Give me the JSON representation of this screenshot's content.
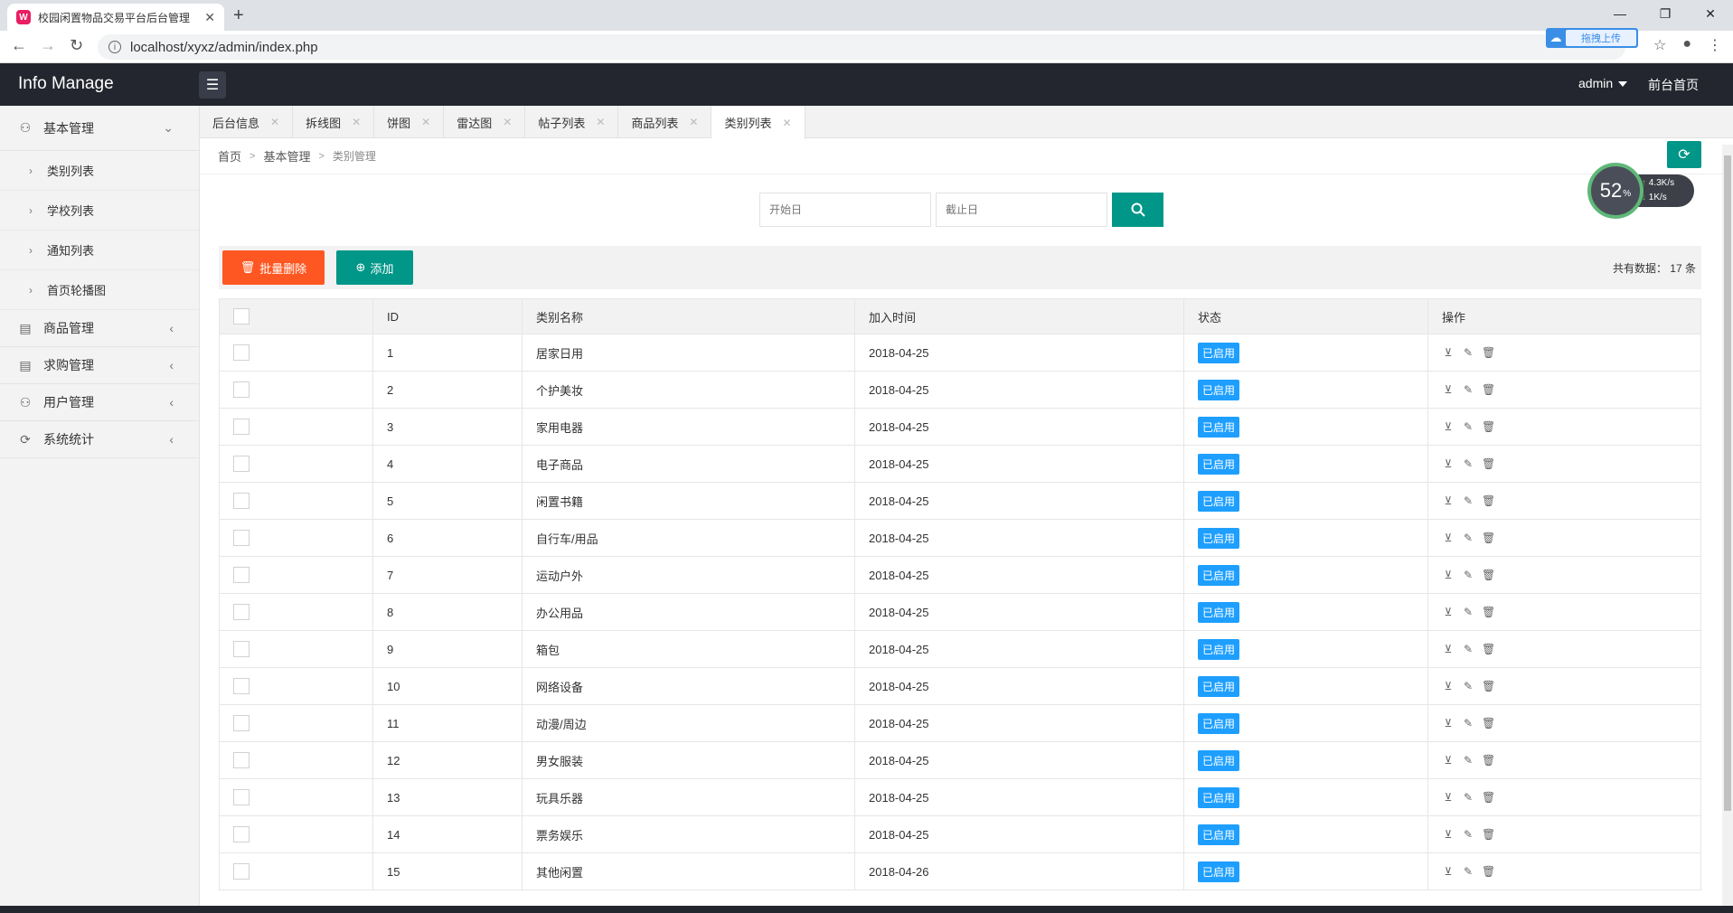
{
  "browser": {
    "tab_title": "校园闲置物品交易平台后台管理",
    "tab_favicon_letter": "W",
    "url": "localhost/xyxz/admin/index.php",
    "extension_label": "拖拽上传"
  },
  "header": {
    "logo": "Info Manage",
    "user": "admin",
    "home_link": "前台首页"
  },
  "sidebar": {
    "groups": [
      {
        "label": "基本管理",
        "icon": "user-icon",
        "expanded": true,
        "items": [
          "类别列表",
          "学校列表",
          "通知列表",
          "首页轮播图"
        ]
      },
      {
        "label": "商品管理",
        "icon": "document-icon"
      },
      {
        "label": "求购管理",
        "icon": "document-icon"
      },
      {
        "label": "用户管理",
        "icon": "user-icon"
      },
      {
        "label": "系统统计",
        "icon": "chart-icon"
      }
    ]
  },
  "tabs": [
    "后台信息",
    "拆线图",
    "饼图",
    "雷达图",
    "帖子列表",
    "商品列表",
    "类别列表"
  ],
  "active_tab": "类别列表",
  "breadcrumb": [
    "首页",
    "基本管理",
    "类别管理"
  ],
  "speed_widget": {
    "percent": "52",
    "unit": "%",
    "up": "4.3K/s",
    "down": "1K/s"
  },
  "search": {
    "start_placeholder": "开始日",
    "end_placeholder": "截止日"
  },
  "toolbar": {
    "batch_delete": "批量删除",
    "add": "添加",
    "total_label": "共有数据： 17 条"
  },
  "table": {
    "headers": [
      "ID",
      "类别名称",
      "加入时间",
      "状态",
      "操作"
    ],
    "rows": [
      {
        "id": "1",
        "name": "居家日用",
        "date": "2018-04-25",
        "status": "已启用"
      },
      {
        "id": "2",
        "name": "个护美妆",
        "date": "2018-04-25",
        "status": "已启用"
      },
      {
        "id": "3",
        "name": "家用电器",
        "date": "2018-04-25",
        "status": "已启用"
      },
      {
        "id": "4",
        "name": "电子商品",
        "date": "2018-04-25",
        "status": "已启用"
      },
      {
        "id": "5",
        "name": "闲置书籍",
        "date": "2018-04-25",
        "status": "已启用"
      },
      {
        "id": "6",
        "name": "自行车/用品",
        "date": "2018-04-25",
        "status": "已启用"
      },
      {
        "id": "7",
        "name": "运动户外",
        "date": "2018-04-25",
        "status": "已启用"
      },
      {
        "id": "8",
        "name": "办公用品",
        "date": "2018-04-25",
        "status": "已启用"
      },
      {
        "id": "9",
        "name": "箱包",
        "date": "2018-04-25",
        "status": "已启用"
      },
      {
        "id": "10",
        "name": "网络设备",
        "date": "2018-04-25",
        "status": "已启用"
      },
      {
        "id": "11",
        "name": "动漫/周边",
        "date": "2018-04-25",
        "status": "已启用"
      },
      {
        "id": "12",
        "name": "男女服装",
        "date": "2018-04-25",
        "status": "已启用"
      },
      {
        "id": "13",
        "name": "玩具乐器",
        "date": "2018-04-25",
        "status": "已启用"
      },
      {
        "id": "14",
        "name": "票务娱乐",
        "date": "2018-04-25",
        "status": "已启用"
      },
      {
        "id": "15",
        "name": "其他闲置",
        "date": "2018-04-26",
        "status": "已启用"
      }
    ]
  },
  "colors": {
    "header_bg": "#23262e",
    "primary": "#009688",
    "danger": "#ff5722",
    "badge": "#1e9fff"
  }
}
